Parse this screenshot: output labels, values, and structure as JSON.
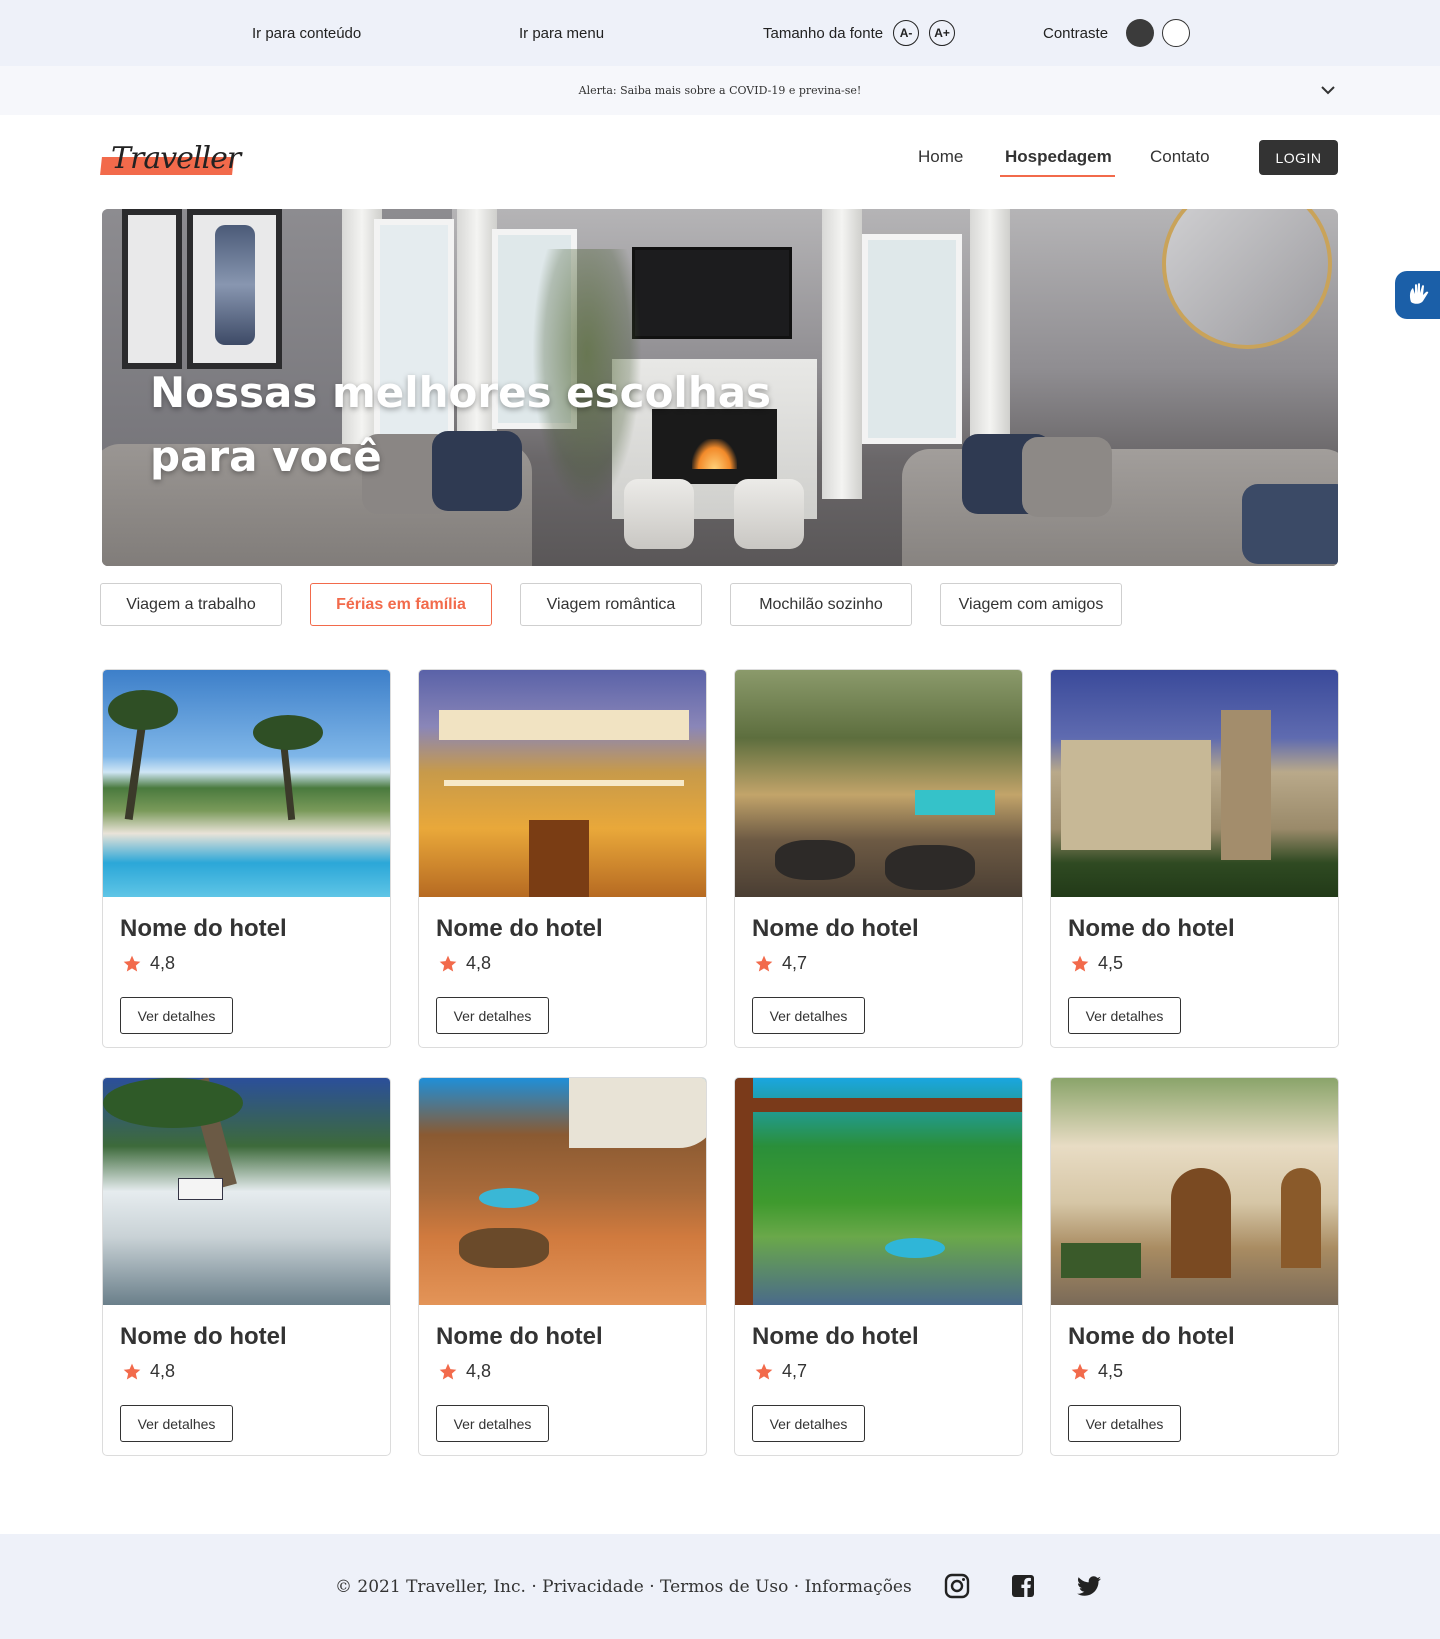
{
  "accessibility": {
    "skip_content": "Ir para conteúdo",
    "skip_menu": "Ir para menu",
    "font_size_label": "Tamanho da fonte",
    "font_decrease": "A-",
    "font_increase": "A+",
    "contrast_label": "Contraste"
  },
  "alert": {
    "text": "Alerta: Saiba mais sobre a COVID-19 e previna-se!"
  },
  "header": {
    "logo_text": "Traveller",
    "nav": [
      "Home",
      "Hospedagem",
      "Contato"
    ],
    "active_nav": "Hospedagem",
    "login_label": "LOGIN"
  },
  "hero": {
    "title_line1": "Nossas melhores escolhas",
    "title_line2": "para você"
  },
  "filters": [
    {
      "label": "Viagem a trabalho",
      "active": false
    },
    {
      "label": "Férias em família",
      "active": true
    },
    {
      "label": "Viagem romântica",
      "active": false
    },
    {
      "label": "Mochilão sozinho",
      "active": false
    },
    {
      "label": "Viagem com amigos",
      "active": false
    }
  ],
  "hotels": [
    {
      "name": "Nome do hotel",
      "rating": "4,8",
      "button": "Ver detalhes"
    },
    {
      "name": "Nome do hotel",
      "rating": "4,8",
      "button": "Ver detalhes"
    },
    {
      "name": "Nome do hotel",
      "rating": "4,7",
      "button": "Ver detalhes"
    },
    {
      "name": "Nome do hotel",
      "rating": "4,5",
      "button": "Ver detalhes"
    },
    {
      "name": "Nome do hotel",
      "rating": "4,8",
      "button": "Ver detalhes"
    },
    {
      "name": "Nome do hotel",
      "rating": "4,8",
      "button": "Ver detalhes"
    },
    {
      "name": "Nome do hotel",
      "rating": "4,7",
      "button": "Ver detalhes"
    },
    {
      "name": "Nome do hotel",
      "rating": "4,5",
      "button": "Ver detalhes"
    }
  ],
  "footer": {
    "copyright": "© 2021 Traveller, Inc.",
    "links": [
      "Privacidade",
      "Termos de Uso",
      "Informações"
    ],
    "social_icons": [
      "instagram-icon",
      "facebook-icon",
      "twitter-icon"
    ]
  },
  "colors": {
    "accent": "#f26a4b",
    "dark": "#333333",
    "bar_background": "#eef1f9",
    "badge_blue": "#1b5fa8"
  }
}
